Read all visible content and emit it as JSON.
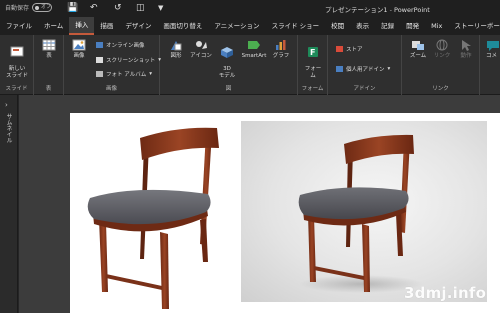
{
  "titlebar": {
    "autosave_label": "自動保存",
    "autosave_state": "オフ",
    "doc_name": "プレゼンテーション1",
    "separator": " - ",
    "app_name": "PowerPoint"
  },
  "tabs": [
    {
      "label": "ファイル"
    },
    {
      "label": "ホーム"
    },
    {
      "label": "挿入",
      "active": true
    },
    {
      "label": "描画"
    },
    {
      "label": "デザイン"
    },
    {
      "label": "画面切り替え"
    },
    {
      "label": "アニメーション"
    },
    {
      "label": "スライド ショー"
    },
    {
      "label": "校閲"
    },
    {
      "label": "表示"
    },
    {
      "label": "記録"
    },
    {
      "label": "開発"
    },
    {
      "label": "Mix"
    },
    {
      "label": "ストーリーボード"
    }
  ],
  "ribbon": {
    "slides": {
      "button": "新しい\nスライド",
      "group": "スライド"
    },
    "tables": {
      "button": "表",
      "group": "表"
    },
    "images": {
      "picture": "画像",
      "online_pictures": "オンライン画像",
      "screenshot": "スクリーンショット",
      "photo_album": "フォト アルバム",
      "group": "画像"
    },
    "illustrations": {
      "shapes": "図形",
      "icons": "アイコン",
      "models3d": "3D\nモデル",
      "smartart": "SmartArt",
      "chart": "グラフ",
      "group": "図"
    },
    "forms": {
      "button": "フォー\nム",
      "group": "フォーム"
    },
    "addins": {
      "store": "ストア",
      "my_addins": "個人用アドイン",
      "group": "アドイン"
    },
    "links": {
      "zoom": "ズーム",
      "link": "リンク",
      "action": "動作",
      "group": "リンク"
    },
    "comments": {
      "button": "コメ"
    }
  },
  "leftpanel": {
    "label": "サムネイル"
  },
  "watermark": "3dmj.info",
  "colors": {
    "accent_tab": "#c55a3b",
    "chair_wood": "#8a3a1f",
    "seat_fabric": "#5a5a60"
  }
}
